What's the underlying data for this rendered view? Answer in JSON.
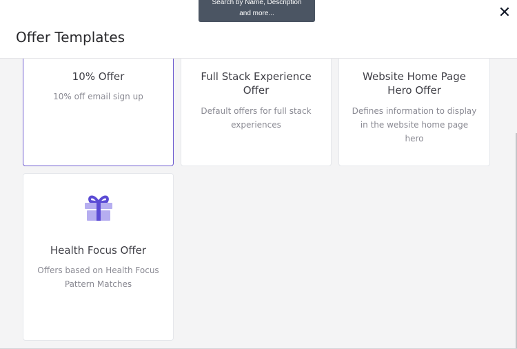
{
  "header": {
    "title": "Offer Templates",
    "close_symbol": "✕"
  },
  "tooltip": {
    "line1": "Search by Name, Description",
    "line2": "and more..."
  },
  "cards": [
    {
      "title": "10% Offer",
      "description": "10% off email sign up"
    },
    {
      "title": "Full Stack Experience Offer",
      "description": "Default offers for full stack experiences"
    },
    {
      "title": "Website Home Page Hero Offer",
      "description": "Defines information to display in the website home page hero"
    },
    {
      "title": "Health Focus Offer",
      "description": "Offers based on Health Focus Pattern Matches"
    }
  ],
  "colors": {
    "accent": "#6d5bd0",
    "gift_icon": "#b6aef0",
    "gift_ribbon": "#5b4bd4"
  }
}
